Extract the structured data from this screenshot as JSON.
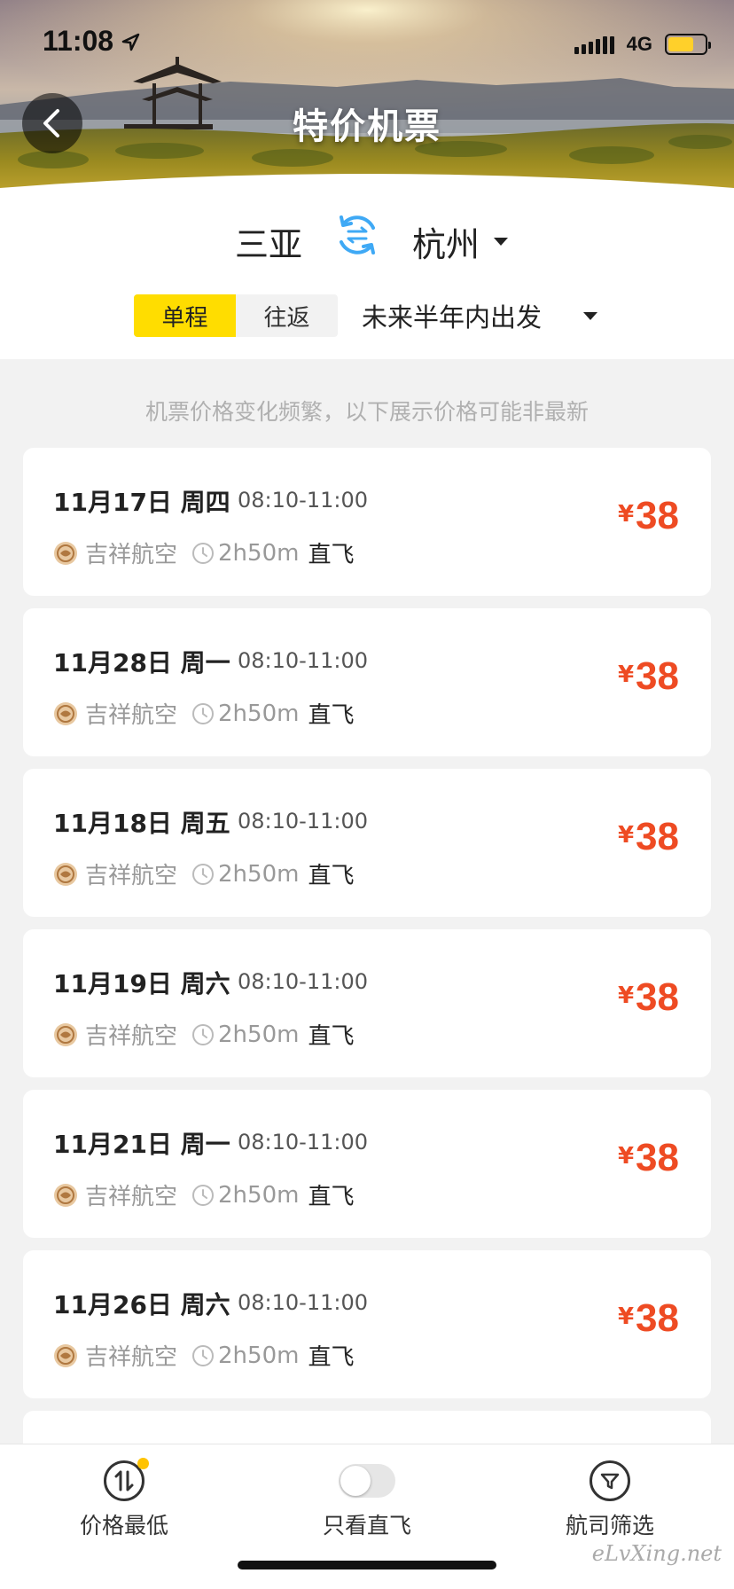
{
  "status_bar": {
    "time": "11:08",
    "network": "4G",
    "icons": [
      "location-arrow-icon",
      "signal-icon",
      "battery-icon"
    ]
  },
  "header": {
    "title": "特价机票",
    "back_icon": "chevron-left-icon"
  },
  "search": {
    "from_city": "三亚",
    "to_city": "杭州",
    "swap_icon": "swap-icon",
    "trip_types": [
      {
        "label": "单程",
        "active": true
      },
      {
        "label": "往返",
        "active": false
      }
    ],
    "date_range": "未来半年内出发"
  },
  "notice": "机票价格变化频繁，以下展示价格可能非最新",
  "flights": [
    {
      "date": "11月17日 周四",
      "time": "08:10-11:00",
      "airline": "吉祥航空",
      "duration": "2h50m",
      "type": "直飞",
      "currency": "¥",
      "price": "38"
    },
    {
      "date": "11月28日 周一",
      "time": "08:10-11:00",
      "airline": "吉祥航空",
      "duration": "2h50m",
      "type": "直飞",
      "currency": "¥",
      "price": "38"
    },
    {
      "date": "11月18日 周五",
      "time": "08:10-11:00",
      "airline": "吉祥航空",
      "duration": "2h50m",
      "type": "直飞",
      "currency": "¥",
      "price": "38"
    },
    {
      "date": "11月19日 周六",
      "time": "08:10-11:00",
      "airline": "吉祥航空",
      "duration": "2h50m",
      "type": "直飞",
      "currency": "¥",
      "price": "38"
    },
    {
      "date": "11月21日 周一",
      "time": "08:10-11:00",
      "airline": "吉祥航空",
      "duration": "2h50m",
      "type": "直飞",
      "currency": "¥",
      "price": "38"
    },
    {
      "date": "11月26日 周六",
      "time": "08:10-11:00",
      "airline": "吉祥航空",
      "duration": "2h50m",
      "type": "直飞",
      "currency": "¥",
      "price": "38"
    }
  ],
  "bottom_bar": {
    "sort_label": "价格最低",
    "direct_label": "只看直飞",
    "direct_only": false,
    "airline_label": "航司筛选"
  },
  "watermark": "eLvXing.net",
  "colors": {
    "accent_yellow": "#ffdd00",
    "price_red": "#ee4b23",
    "swap_blue": "#3fa9f5"
  }
}
